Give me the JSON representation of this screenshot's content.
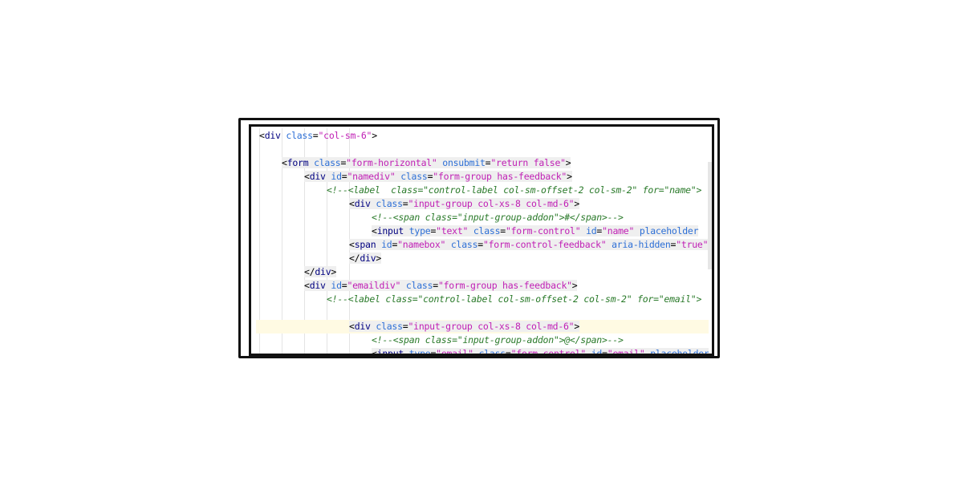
{
  "editor": {
    "lines": [
      {
        "indent": 0,
        "parts": [
          [
            "p",
            "<"
          ],
          [
            "t",
            "div"
          ],
          [
            "s",
            " "
          ],
          [
            "a",
            "class"
          ],
          [
            "p",
            "="
          ],
          [
            "v",
            "\"col-sm-6\""
          ],
          [
            "p",
            ">"
          ]
        ],
        "bg": false
      },
      {
        "indent": 0,
        "parts": [],
        "bg": false
      },
      {
        "indent": 1,
        "parts": [
          [
            "p",
            "<"
          ],
          [
            "t",
            "form"
          ],
          [
            "s",
            " "
          ],
          [
            "a",
            "class"
          ],
          [
            "p",
            "="
          ],
          [
            "v",
            "\"form-horizontal\""
          ],
          [
            "s",
            " "
          ],
          [
            "a",
            "onsubmit"
          ],
          [
            "p",
            "="
          ],
          [
            "v",
            "\"return false\""
          ],
          [
            "p",
            ">"
          ]
        ],
        "bg": true
      },
      {
        "indent": 2,
        "parts": [
          [
            "p",
            "<"
          ],
          [
            "t",
            "div"
          ],
          [
            "s",
            " "
          ],
          [
            "a",
            "id"
          ],
          [
            "p",
            "="
          ],
          [
            "v",
            "\"namediv\""
          ],
          [
            "s",
            " "
          ],
          [
            "a",
            "class"
          ],
          [
            "p",
            "="
          ],
          [
            "v",
            "\"form-group has-feedback\""
          ],
          [
            "p",
            ">"
          ]
        ],
        "bg": true
      },
      {
        "indent": 3,
        "parts": [
          [
            "c",
            "<!--<label  class=\"control-label col-sm-offset-2 col-sm-2\" for=\"name\">"
          ]
        ],
        "bg": false
      },
      {
        "indent": 4,
        "parts": [
          [
            "p",
            "<"
          ],
          [
            "t",
            "div"
          ],
          [
            "s",
            " "
          ],
          [
            "a",
            "class"
          ],
          [
            "p",
            "="
          ],
          [
            "v",
            "\"input-group col-xs-8 col-md-6\""
          ],
          [
            "p",
            ">"
          ]
        ],
        "bg": true
      },
      {
        "indent": 5,
        "parts": [
          [
            "c",
            "<!--<span class=\"input-group-addon\">#</span>-->"
          ]
        ],
        "bg": false
      },
      {
        "indent": 5,
        "parts": [
          [
            "p",
            "<"
          ],
          [
            "t",
            "input"
          ],
          [
            "s",
            " "
          ],
          [
            "a",
            "type"
          ],
          [
            "p",
            "="
          ],
          [
            "v",
            "\"text\""
          ],
          [
            "s",
            " "
          ],
          [
            "a",
            "class"
          ],
          [
            "p",
            "="
          ],
          [
            "v",
            "\"form-control\""
          ],
          [
            "s",
            " "
          ],
          [
            "a",
            "id"
          ],
          [
            "p",
            "="
          ],
          [
            "v",
            "\"name\""
          ],
          [
            "s",
            " "
          ],
          [
            "a",
            "placeholder"
          ]
        ],
        "bg": true
      },
      {
        "indent": 4,
        "parts": [
          [
            "p",
            "<"
          ],
          [
            "t",
            "span"
          ],
          [
            "s",
            " "
          ],
          [
            "a",
            "id"
          ],
          [
            "p",
            "="
          ],
          [
            "v",
            "\"namebox\""
          ],
          [
            "s",
            " "
          ],
          [
            "a",
            "class"
          ],
          [
            "p",
            "="
          ],
          [
            "v",
            "\"form-control-feedback\""
          ],
          [
            "s",
            " "
          ],
          [
            "a",
            "aria-hidden"
          ],
          [
            "p",
            "="
          ],
          [
            "v",
            "\"true\""
          ]
        ],
        "bg": true
      },
      {
        "indent": 4,
        "parts": [
          [
            "p",
            "</"
          ],
          [
            "t",
            "div"
          ],
          [
            "p",
            ">"
          ]
        ],
        "bg": true
      },
      {
        "indent": 2,
        "parts": [
          [
            "p",
            "</"
          ],
          [
            "t",
            "div"
          ],
          [
            "p",
            ">"
          ]
        ],
        "bg": true
      },
      {
        "indent": 2,
        "parts": [
          [
            "p",
            "<"
          ],
          [
            "t",
            "div"
          ],
          [
            "s",
            " "
          ],
          [
            "a",
            "id"
          ],
          [
            "p",
            "="
          ],
          [
            "v",
            "\"emaildiv\""
          ],
          [
            "s",
            " "
          ],
          [
            "a",
            "class"
          ],
          [
            "p",
            "="
          ],
          [
            "v",
            "\"form-group has-feedback\""
          ],
          [
            "p",
            ">"
          ]
        ],
        "bg": true
      },
      {
        "indent": 3,
        "parts": [
          [
            "c",
            "<!--<label class=\"control-label col-sm-offset-2 col-sm-2\" for=\"email\">"
          ]
        ],
        "bg": false
      },
      {
        "indent": 0,
        "parts": [],
        "bg": false
      },
      {
        "indent": 4,
        "parts": [
          [
            "p",
            "<"
          ],
          [
            "t",
            "div"
          ],
          [
            "s",
            " "
          ],
          [
            "a",
            "class"
          ],
          [
            "p",
            "="
          ],
          [
            "v",
            "\"input-group col-xs-8 col-md-6\""
          ],
          [
            "p",
            ">"
          ]
        ],
        "bg": true,
        "current": true
      },
      {
        "indent": 5,
        "parts": [
          [
            "c",
            "<!--<span class=\"input-group-addon\">@</span>-->"
          ]
        ],
        "bg": false
      },
      {
        "indent": 5,
        "parts": [
          [
            "p",
            "<"
          ],
          [
            "t",
            "input"
          ],
          [
            "s",
            " "
          ],
          [
            "a",
            "type"
          ],
          [
            "p",
            "="
          ],
          [
            "v",
            "\"email\""
          ],
          [
            "s",
            " "
          ],
          [
            "a",
            "class"
          ],
          [
            "p",
            "="
          ],
          [
            "v",
            "\"form-control\""
          ],
          [
            "s",
            " "
          ],
          [
            "a",
            "id"
          ],
          [
            "p",
            "="
          ],
          [
            "v",
            "\"email\""
          ],
          [
            "s",
            " "
          ],
          [
            "a",
            "placeholder"
          ]
        ],
        "bg": true
      }
    ]
  },
  "colors": {
    "frame": "#111111",
    "tag": "#000080",
    "attr": "#2d6fd6",
    "string": "#c020b5",
    "comment": "#2a7a2a",
    "current_line": "#fffae3"
  }
}
